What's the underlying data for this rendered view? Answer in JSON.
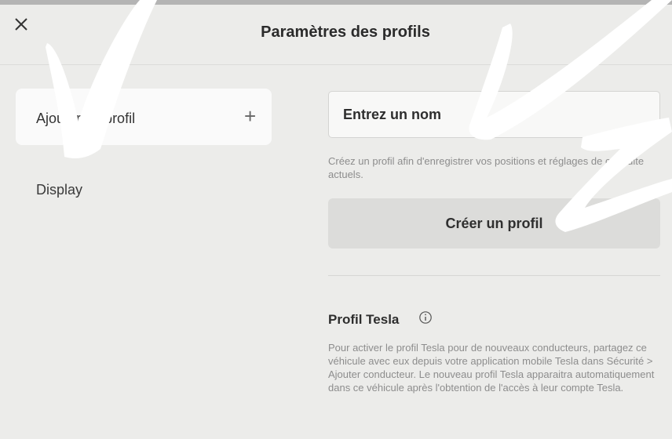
{
  "header": {
    "title": "Paramètres des profils",
    "close_icon": "close-icon"
  },
  "sidebar": {
    "add_profile_label": "Ajouter un profil",
    "add_icon": "plus-icon",
    "display_label": "Display"
  },
  "form": {
    "name_placeholder": "Entrez un nom",
    "help_text": "Créez un profil afin d'enregistrer vos positions et réglages de conduite actuels.",
    "create_button_label": "Créer un profil"
  },
  "tesla_profile": {
    "title": "Profil Tesla",
    "info_icon": "info-icon",
    "description": "Pour activer le profil Tesla pour de nouveaux conducteurs, partagez ce véhicule avec eux depuis votre application mobile Tesla dans Sécurité > Ajouter conducteur. Le nouveau profil Tesla apparaitra automatiquement dans ce véhicule après l'obtention de l'accès à leur compte Tesla."
  },
  "colors": {
    "background": "#ececea",
    "card": "#fafafa",
    "button": "#dcdcda",
    "annotation": "#ffffff"
  }
}
